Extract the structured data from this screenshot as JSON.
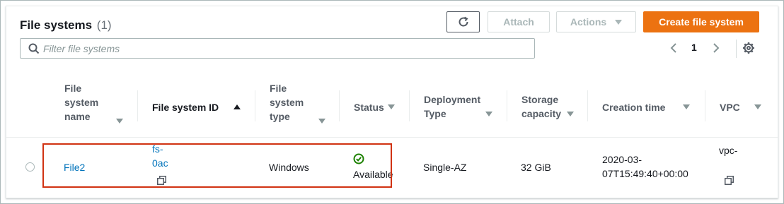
{
  "header": {
    "title": "File systems",
    "count": "(1)",
    "refresh_icon": "refresh-icon",
    "attach_label": "Attach",
    "actions_label": "Actions",
    "create_label": "Create file system"
  },
  "search": {
    "placeholder": "Filter file systems",
    "value": ""
  },
  "pagination": {
    "current_page": "1"
  },
  "columns": {
    "name": [
      "File",
      "system",
      "name"
    ],
    "id": "File system ID",
    "type": [
      "File",
      "system",
      "type"
    ],
    "status": "Status",
    "deployment": [
      "Deployment",
      "Type"
    ],
    "storage": [
      "Storage",
      "capacity"
    ],
    "creation": "Creation time",
    "vpc": "VPC"
  },
  "rows": [
    {
      "name": "File2",
      "id": [
        "fs-",
        "0ac"
      ],
      "type": "Windows",
      "status": "Available",
      "deployment": "Single-AZ",
      "storage": "32 GiB",
      "creation": [
        "2020-03-",
        "07T15:49:40+00:00"
      ],
      "vpc": "vpc-"
    }
  ],
  "colors": {
    "primary": "#ec7211",
    "link": "#0073bb",
    "success": "#1d8102",
    "highlight": "#d13212"
  }
}
